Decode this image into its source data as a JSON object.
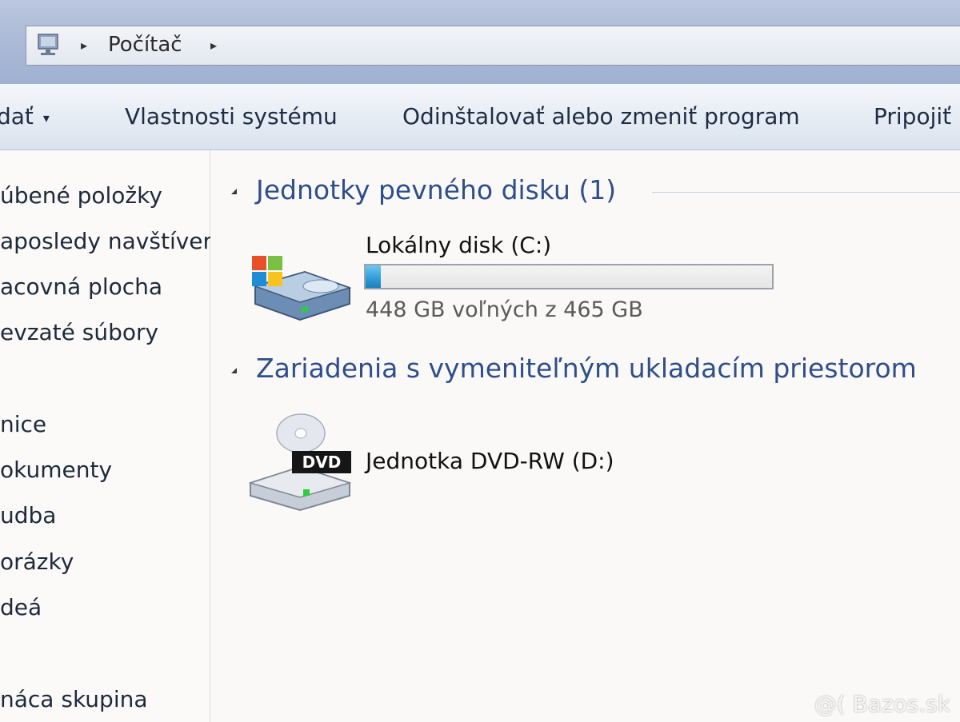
{
  "address": {
    "path_label": "Počítač",
    "arrow": "▸"
  },
  "toolbar": {
    "items": [
      {
        "label": "dať",
        "has_dropdown": true
      },
      {
        "label": "Vlastnosti systému"
      },
      {
        "label": "Odinštalovať alebo zmeniť program"
      },
      {
        "label": "Pripojiť"
      }
    ],
    "dropdown_glyph": "▾"
  },
  "nav": {
    "items": [
      {
        "label": "úbené položky"
      },
      {
        "label": "aposledy navštíver"
      },
      {
        "label": "acovná plocha"
      },
      {
        "label": "evzaté súbory"
      },
      {
        "label": "nice"
      },
      {
        "label": "okumenty"
      },
      {
        "label": "udba"
      },
      {
        "label": "orázky"
      },
      {
        "label": "deá"
      },
      {
        "label": "náca skupina"
      }
    ]
  },
  "groups": [
    {
      "title": "Jednotky pevného disku (1)",
      "items": [
        {
          "name": "Lokálny disk (C:)",
          "free_text": "448 GB voľných z 465 GB",
          "used_fraction": 0.037,
          "icon": "hard-drive-icon"
        }
      ]
    },
    {
      "title": "Zariadenia s vymeniteľným ukladacím priestorom",
      "items": [
        {
          "name": "Jednotka DVD-RW (D:)",
          "icon": "dvd-drive-icon",
          "icon_label": "DVD"
        }
      ]
    }
  ],
  "watermark": "@( Bazos.sk",
  "colors": {
    "group_header": "#2e4e8c",
    "progress_fill": "#2f9bd6"
  }
}
